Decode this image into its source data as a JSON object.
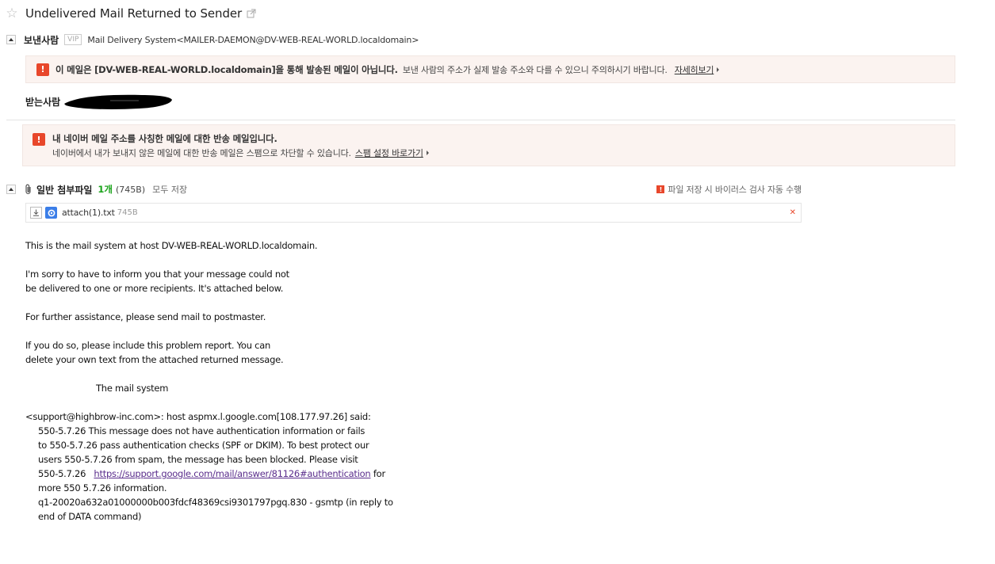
{
  "subject": {
    "title": "Undelivered Mail Returned to Sender"
  },
  "sender": {
    "label": "보낸사람",
    "vip": "VIP",
    "value": "Mail Delivery System<MAILER-DAEMON@DV-WEB-REAL-WORLD.localdomain>"
  },
  "warning_spoof": {
    "strong": "이 메일은 [DV-WEB-REAL-WORLD.localdomain]을 통해 발송된 메일이 아닙니다.",
    "text": "보낸 사람의 주소가 실제 발송 주소와 다를 수 있으니 주의하시기 바랍니다.",
    "link": "자세히보기"
  },
  "recipient": {
    "label": "받는사람"
  },
  "warning_bounce": {
    "title": "내 네이버 메일 주소를 사칭한 메일에 대한 반송 메일입니다.",
    "text": "네이버에서 내가 보내지 않은 메일에 대한 반송 메일은 스팸으로 차단할 수 있습니다.",
    "link": "스팸 설정 바로가기"
  },
  "attachments": {
    "label": "일반 첨부파일",
    "count": "1개",
    "total_size": "(745B)",
    "save_all": "모두 저장",
    "virus_note": "파일 저장 시 바이러스 검사 자동 수행",
    "files": [
      {
        "name": "attach(1).txt",
        "size": "745B"
      }
    ]
  },
  "body": {
    "lines": [
      "This is the mail system at host DV-WEB-REAL-WORLD.localdomain.",
      "",
      "I'm sorry to have to inform you that your message could not",
      "be delivered to one or more recipients. It's attached below.",
      "",
      "For further assistance, please send mail to postmaster.",
      "",
      "If you do so, please include this problem report. You can",
      "delete your own text from the attached returned message.",
      "",
      "The mail system",
      "",
      "<support@highbrow-inc.com>: host aspmx.l.google.com[108.177.97.26] said:",
      "550-5.7.26 This message does not have authentication information or fails",
      "to 550-5.7.26 pass authentication checks (SPF or DKIM). To best protect our",
      "users 550-5.7.26 from spam, the message has been blocked. Please visit",
      "550-5.7.26",
      "more 550 5.7.26 information.",
      "q1-20020a632a01000000b003fdcf48369csi9301797pgq.830 - gsmtp (in reply to",
      "end of DATA command)"
    ],
    "link_url": "https://support.google.com/mail/answer/81126#authentication",
    "link_suffix": " for"
  }
}
